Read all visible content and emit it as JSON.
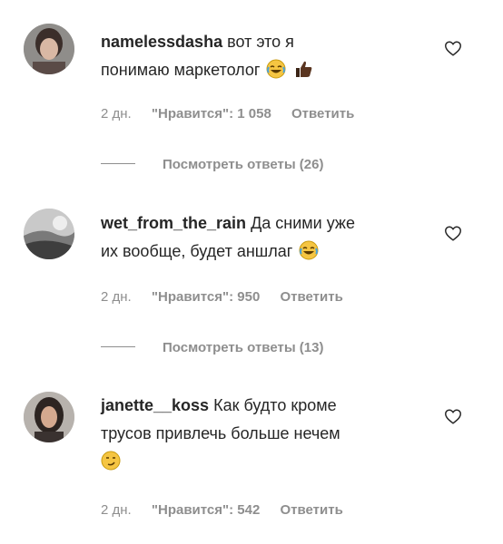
{
  "comments": [
    {
      "username": "namelessdasha",
      "text_lines": [
        "вот это я",
        "понимаю маркетолог"
      ],
      "emojis": [
        "laughing-tears-emoji",
        "thumbs-up-emoji"
      ],
      "time": "2 дн.",
      "likes": "\"Нравится\": 1 058",
      "reply_label": "Ответить",
      "view_replies": "Посмотреть ответы (26)"
    },
    {
      "username": "wet_from_the_rain",
      "text_lines": [
        "Да сними уже",
        "их вообще, будет аншлаг"
      ],
      "emojis": [
        "laughing-tears-emoji"
      ],
      "time": "2 дн.",
      "likes": "\"Нравится\": 950",
      "reply_label": "Ответить",
      "view_replies": "Посмотреть ответы (13)"
    },
    {
      "username": "janette__koss",
      "text_lines": [
        "Как будто кроме",
        "трусов привлечь больше нечем"
      ],
      "emojis": [
        "smirking-face-emoji"
      ],
      "time": "2 дн.",
      "likes": "\"Нравится\": 542",
      "reply_label": "Ответить"
    }
  ],
  "colors": {
    "text": "#262626",
    "secondary": "#8e8e8e",
    "emoji_yellow": "#f5c542"
  }
}
